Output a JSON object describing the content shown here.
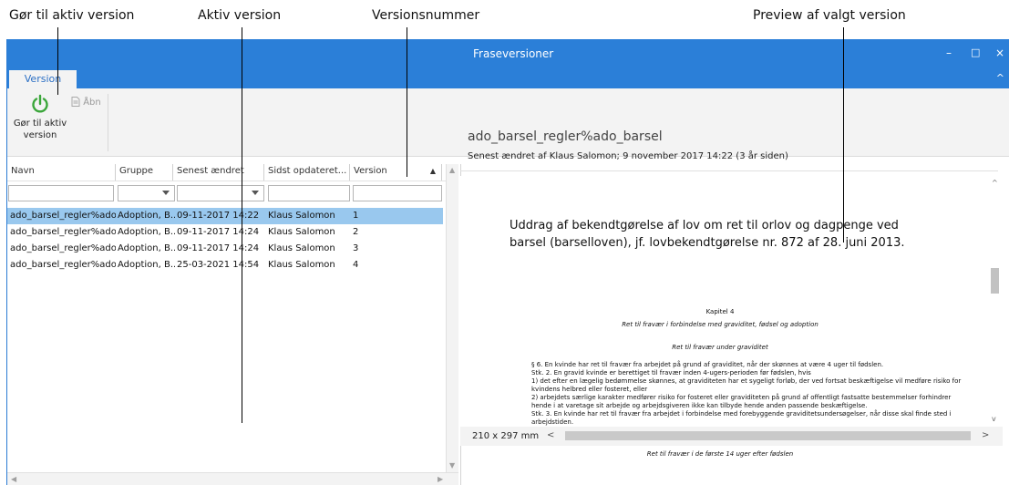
{
  "annotations": {
    "make_active": "Gør til aktiv version",
    "active": "Aktiv version",
    "version_number": "Versionsnummer",
    "preview": "Preview af valgt version"
  },
  "window": {
    "title": "Fraseversioner",
    "minimize_glyph": "–",
    "maximize_glyph": "□",
    "close_glyph": "×",
    "collapse_glyph": "^"
  },
  "ribbon": {
    "tab": "Version",
    "make_active_line1": "Gør til aktiv",
    "make_active_line2": "version",
    "open": "Åbn"
  },
  "grid": {
    "columns": [
      "Navn",
      "Gruppe",
      "Senest ændret",
      "Sidst opdateret...",
      "Version"
    ],
    "sort_glyph": "▲",
    "rows": [
      {
        "name": "ado_barsel_regler%ado...",
        "group": "Adoption, B...",
        "changed": "09-11-2017 14:22",
        "updated_by": "Klaus Salomon",
        "version": "1",
        "selected": true
      },
      {
        "name": "ado_barsel_regler%ado...",
        "group": "Adoption, B...",
        "changed": "09-11-2017 14:24",
        "updated_by": "Klaus Salomon",
        "version": "2",
        "selected": false
      },
      {
        "name": "ado_barsel_regler%ado...",
        "group": "Adoption, B...",
        "changed": "09-11-2017 14:24",
        "updated_by": "Klaus Salomon",
        "version": "3",
        "selected": false
      },
      {
        "name": "ado_barsel_regler%ado...",
        "group": "Adoption, B...",
        "changed": "25-03-2021 14:54",
        "updated_by": "Klaus Salomon",
        "version": "4",
        "selected": false
      }
    ]
  },
  "preview": {
    "title": "ado_barsel_regler%ado_barsel",
    "subtitle": "Senest ændret af Klaus Salomon; 9 november 2017 14:22 (3 år siden)",
    "doc_heading": "Uddrag af bekendtgørelse af lov om ret til orlov og dagpenge ved barsel (barselloven), jf. lovbekendtgørelse nr. 872 af 28. juni 2013.",
    "chapter": "Kapitel 4",
    "chapter_sub": "Ret til fravær i forbindelse med graviditet, fødsel og adoption",
    "section_title": "Ret til fravær under graviditet",
    "para1": "§ 6. En kvinde har ret til fravær fra arbejdet på grund af graviditet, når der skønnes at være 4 uger til fødslen.",
    "para2": "Stk. 2. En gravid kvinde er berettiget til fravær inden 4-ugers-perioden før fødslen, hvis",
    "para3": "1) det efter en lægelig bedømmelse skønnes, at graviditeten har et sygeligt forløb, der ved fortsat beskæftigelse vil medføre risiko for kvindens helbred eller fosteret, eller",
    "para4": "2) arbejdets særlige karakter medfører risiko for fosteret eller graviditeten på grund af offentligt fastsatte bestemmelser forhindrer hende i at varetage sit arbejde og arbejdsgiveren ikke kan tilbyde hende anden passende beskæftigelse.",
    "para5": "Stk. 3. En kvinde har ret til fravær fra arbejdet i forbindelse med forebyggende graviditetsundersøgelser, når disse skal finde sted i arbejdstiden.",
    "section2_title": "Ret til fravær i de første 14 uger efter fødslen",
    "page_size": "210 x 297 mm"
  }
}
